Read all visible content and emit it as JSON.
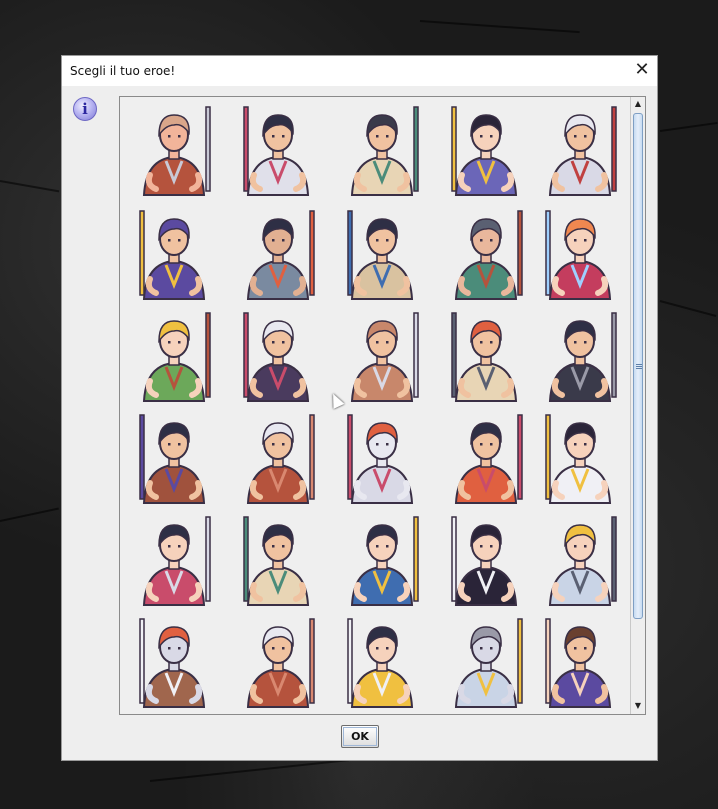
{
  "dialog": {
    "title": "Scegli il tuo eroe!",
    "close_glyph": "✕",
    "info_icon_glyph": "i",
    "ok_label": "OK"
  },
  "scrollbar": {
    "up_glyph": "▲",
    "down_glyph": "▼",
    "visible_fraction": 0.86
  },
  "heroes": [
    {
      "name": "barbarian",
      "skin": "#f2b49a",
      "hair": "#d9a68a",
      "cloth": "#b5533d",
      "accent": "#c9c9d6"
    },
    {
      "name": "swordsman",
      "skin": "#f0c2a0",
      "hair": "#2e2f45",
      "cloth": "#e0e0ea",
      "accent": "#c94c6b"
    },
    {
      "name": "explorer",
      "skin": "#f0c2a0",
      "hair": "#3a3a4a",
      "cloth": "#e8d5b5",
      "accent": "#4b8c7a"
    },
    {
      "name": "queen",
      "skin": "#f6d2bc",
      "hair": "#2a2438",
      "cloth": "#6b66b8",
      "accent": "#f0c040"
    },
    {
      "name": "crusader",
      "skin": "#f0c2a0",
      "hair": "#e8e8f0",
      "cloth": "#d9d9e6",
      "accent": "#c04040"
    },
    {
      "name": "jester",
      "skin": "#f0c2a0",
      "hair": "#5b4aa0",
      "cloth": "#5b4aa0",
      "accent": "#f0c040"
    },
    {
      "name": "bandit",
      "skin": "#e2b092",
      "hair": "#2e2f45",
      "cloth": "#7a8aa0",
      "accent": "#e06040"
    },
    {
      "name": "crossbowman",
      "skin": "#f0c2a0",
      "hair": "#2e2f45",
      "cloth": "#d9c2a0",
      "accent": "#3f6db0"
    },
    {
      "name": "beastmaster",
      "skin": "#e9b79c",
      "hair": "#5a6072",
      "cloth": "#4b8c7a",
      "accent": "#b5533d"
    },
    {
      "name": "sorceress",
      "skin": "#f6d2bc",
      "hair": "#f08850",
      "cloth": "#c43d5e",
      "accent": "#9fd0ff"
    },
    {
      "name": "archer",
      "skin": "#f6d2bc",
      "hair": "#f0c040",
      "cloth": "#6ca85a",
      "accent": "#b5533d"
    },
    {
      "name": "dual-blade-warrior",
      "skin": "#f0c2a0",
      "hair": "#e8e8f0",
      "cloth": "#4a3b5e",
      "accent": "#c94c6b"
    },
    {
      "name": "hooded-hunter",
      "skin": "#f0c2a0",
      "hair": "#c8876b",
      "cloth": "#c8876b",
      "accent": "#d9d9e6"
    },
    {
      "name": "fisherman",
      "skin": "#f0c2a0",
      "hair": "#e06040",
      "cloth": "#e8d5b5",
      "accent": "#5a6072"
    },
    {
      "name": "ninja",
      "skin": "#f0c2a0",
      "hair": "#2e2f45",
      "cloth": "#3a3a4a",
      "accent": "#9a9aa8"
    },
    {
      "name": "monk",
      "skin": "#f0c2a0",
      "hair": "#2e2f45",
      "cloth": "#a0523d",
      "accent": "#5b4aa0"
    },
    {
      "name": "old-wizard",
      "skin": "#f0c2a0",
      "hair": "#e8e8f0",
      "cloth": "#b5533d",
      "accent": "#d98870"
    },
    {
      "name": "dragon-knight",
      "skin": "#e8e8f0",
      "hair": "#e06040",
      "cloth": "#d9d9e6",
      "accent": "#c94c6b"
    },
    {
      "name": "alchemist",
      "skin": "#f0c2a0",
      "hair": "#2e2f45",
      "cloth": "#e06040",
      "accent": "#c94c6b"
    },
    {
      "name": "prince",
      "skin": "#f6d2bc",
      "hair": "#2a2438",
      "cloth": "#f0f0f5",
      "accent": "#f0c040"
    },
    {
      "name": "samurai-woman",
      "skin": "#f6d2bc",
      "hair": "#2e2f45",
      "cloth": "#c94c6b",
      "accent": "#d9d9e6"
    },
    {
      "name": "traveler",
      "skin": "#f0c2a0",
      "hair": "#2e2f45",
      "cloth": "#e8d5b5",
      "accent": "#4b8c7a"
    },
    {
      "name": "priestess",
      "skin": "#f6d2bc",
      "hair": "#2e2f45",
      "cloth": "#3f6db0",
      "accent": "#f0c040"
    },
    {
      "name": "dark-princess",
      "skin": "#f6d2bc",
      "hair": "#2a2438",
      "cloth": "#2a2438",
      "accent": "#f0f0f5"
    },
    {
      "name": "shield-maiden",
      "skin": "#f6d2bc",
      "hair": "#f0c040",
      "cloth": "#c9d4e6",
      "accent": "#5a6072"
    },
    {
      "name": "mounted-knight",
      "skin": "#d9d9e6",
      "hair": "#e06040",
      "cloth": "#a0664d",
      "accent": "#f0f0f5"
    },
    {
      "name": "wizard-hat",
      "skin": "#f0c2a0",
      "hair": "#e8e8f0",
      "cloth": "#b5533d",
      "accent": "#d98870"
    },
    {
      "name": "barmaid",
      "skin": "#f6d2bc",
      "hair": "#2e2f45",
      "cloth": "#f0c040",
      "accent": "#f0f0f5"
    },
    {
      "name": "heavy-knight",
      "skin": "#d9d9e6",
      "hair": "#9a9aa8",
      "cloth": "#c9d4e6",
      "accent": "#f0c040"
    },
    {
      "name": "martial-artist",
      "skin": "#f0c2a0",
      "hair": "#6a4030",
      "cloth": "#5b4aa0",
      "accent": "#f6d2bc"
    }
  ]
}
